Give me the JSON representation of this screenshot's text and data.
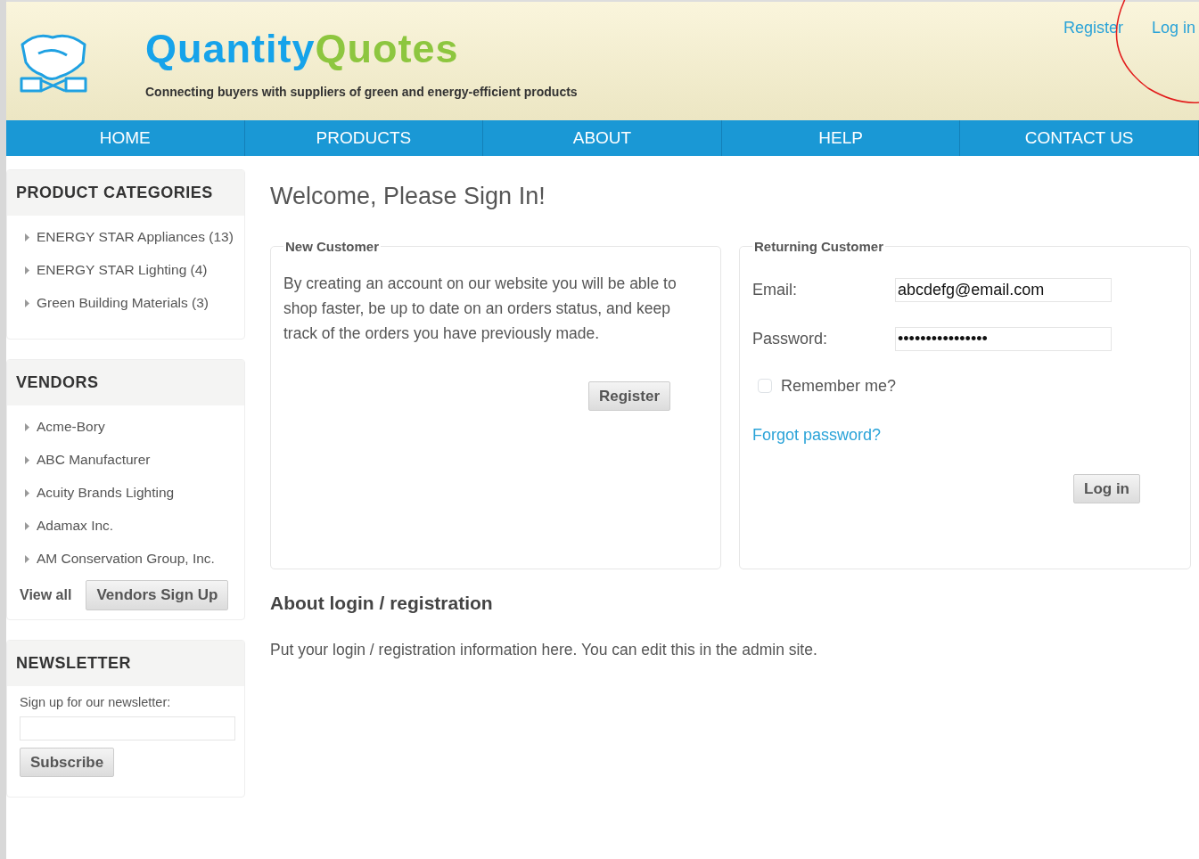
{
  "header": {
    "logo_parts": [
      {
        "text": "Quantity",
        "kind": "primary"
      },
      {
        "text": "Quotes",
        "kind": "secondary"
      }
    ],
    "tagline": "Connecting buyers with suppliers of green and energy-efficient products",
    "links": [
      "Register",
      "Log in"
    ],
    "highlight": {
      "kind": "circle"
    }
  },
  "nav": [
    "HOME",
    "PRODUCTS",
    "ABOUT",
    "HELP",
    "CONTACT US"
  ],
  "sidebar": {
    "categories": {
      "title": "PRODUCT CATEGORIES",
      "items": [
        "ENERGY STAR Appliances (13)",
        "ENERGY STAR Lighting (4)",
        "Green Building Materials (3)"
      ]
    },
    "vendors": {
      "title": "VENDORS",
      "items": [
        "Acme-Bory",
        "ABC Manufacturer",
        "Acuity Brands Lighting",
        "Adamax Inc.",
        "AM Conservation Group, Inc."
      ],
      "view_all": "View all",
      "signup_button": "Vendors Sign Up"
    },
    "newsletter": {
      "title": "NEWSLETTER",
      "label": "Sign up for our newsletter:",
      "button": "Subscribe"
    }
  },
  "main": {
    "title": "Welcome, Please Sign In!",
    "new_customer": {
      "legend": "New Customer",
      "text": "By creating an account on our website you will be able to shop faster, be up to date on an orders status, and keep track of the orders you have previously made.",
      "button": "Register"
    },
    "returning_customer": {
      "legend": "Returning Customer",
      "email_label": "Email:",
      "email_value": "abcdefg@email.com",
      "password_label": "Password:",
      "password_value": "••••••••••••••••",
      "remember": {
        "label": "Remember me?",
        "checked": false
      },
      "forgot": "Forgot password?",
      "button": "Log in"
    },
    "about": {
      "title": "About login / registration",
      "text": "Put your login / registration information here. You can edit this in the admin site."
    }
  }
}
